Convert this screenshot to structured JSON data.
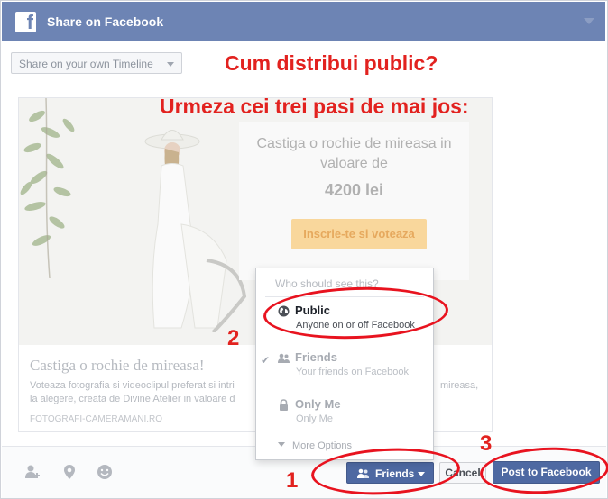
{
  "header": {
    "title": "Share on Facebook",
    "logo_letter": "f"
  },
  "timeline_select": {
    "label": "Share on your own Timeline"
  },
  "annotation": {
    "title": "Cum distribui public?",
    "subtitle": "Urmeza cei trei pasi de mai jos:",
    "step_numbers": [
      "1",
      "2",
      "3"
    ],
    "color": "#e2221f"
  },
  "preview": {
    "ad_title": "Castiga o rochie de mireasa in valoare de",
    "ad_price": "4200 lei",
    "ad_button": "Inscrie-te si voteaza",
    "link_title": "Castiga o rochie de mireasa!",
    "link_desc_line1": "Voteaza fotografia si videoclipul preferat si intri",
    "link_desc_more": "mireasa,",
    "link_desc_line2": "la alegere, creata de Divine Atelier in valoare d",
    "domain": "FOTOGRAFI-CAMERAMANI.RO"
  },
  "audience": {
    "heading": "Who should see this?",
    "options": [
      {
        "name": "Public",
        "desc": "Anyone on or off Facebook",
        "icon": "globe-icon",
        "selected": false
      },
      {
        "name": "Friends",
        "desc": "Your friends on Facebook",
        "icon": "friends-icon",
        "selected": true
      },
      {
        "name": "Only Me",
        "desc": "Only Me",
        "icon": "lock-icon",
        "selected": false
      }
    ],
    "more": "More Options"
  },
  "footer": {
    "icons": [
      "tag-people-icon",
      "location-icon",
      "feeling-icon"
    ],
    "audience_button": "Friends",
    "cancel_button": "Cancel",
    "post_button": "Post to Facebook"
  },
  "colors": {
    "facebook_header": "#6d84b4",
    "facebook_button": "#4e69a2"
  }
}
